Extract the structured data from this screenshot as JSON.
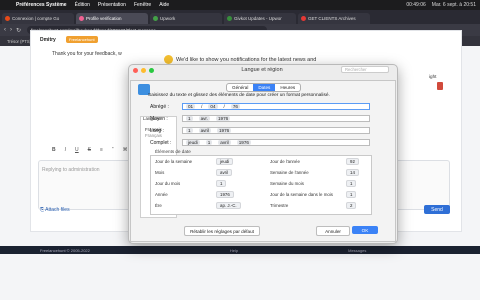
{
  "menubar": {
    "app": "Préférences Système",
    "items": [
      "Édition",
      "Présentation",
      "Fenêtre",
      "Aide"
    ],
    "clock": "Mar. 6 sept. à 20:51",
    "status": "00:49:06"
  },
  "tabs": [
    {
      "label": "Connexion | compte Go",
      "color": "#e64a19",
      "active": false
    },
    {
      "label": "Profile verification",
      "color": "#f06292",
      "active": true
    },
    {
      "label": "Upwork",
      "color": "#43a047",
      "active": false
    },
    {
      "label": "Givkot Updates - Upwor",
      "color": "#388e3c",
      "active": false
    },
    {
      "label": "GET CLIENTS Archives",
      "color": "#e53935",
      "active": false
    }
  ],
  "url": "freelancehunt.com/mailbox/read/thread/600123/#last-message",
  "bookmarks": [
    "Trésor (PTS)",
    "Livre - Éditions D.",
    "Chat with Le LIS",
    "Mémo Extra - Utilis",
    "ActuaBlitz | RBSE",
    "The Webinare | Ro",
    "Connexion | Sasa",
    "Prise en charge"
  ],
  "chat": {
    "user": "Dmitry",
    "badge": "Freelancehunt",
    "message": "Thank you for your feedback, w",
    "reply_placeholder": "Replying to administration",
    "attach": "Attach files",
    "send": "Send",
    "right_label": "ight",
    "toolbar": [
      "B",
      "I",
      "U",
      "S",
      "≡",
      "“",
      "⌘"
    ]
  },
  "notification": "We'd like to show you notifications for the latest news and",
  "footer": {
    "left": "Freelancehunt © 2005-2022",
    "mid": "Help",
    "right": "Messages"
  },
  "prefwin": {
    "title": "Langue et région",
    "search_placeholder": "Rechercher",
    "seg": [
      {
        "label": "Général",
        "selected": false
      },
      {
        "label": "Dates",
        "selected": true
      },
      {
        "label": "Heures",
        "selected": false
      }
    ],
    "hint": "Saisissez du texte et glissez des éléments de date pour créer un format personnalisé.",
    "left_title": "Langues",
    "left_items": [
      "Français",
      "Français"
    ],
    "rows": [
      {
        "label": "Abrégé :",
        "tokens": [
          "01",
          "/",
          "04",
          "/",
          "76"
        ],
        "focus": true
      },
      {
        "label": "Moyen :",
        "tokens": [
          "1",
          "avr.",
          "1976"
        ],
        "focus": false
      },
      {
        "label": "Long :",
        "tokens": [
          "1",
          "avril",
          "1976"
        ],
        "focus": false
      },
      {
        "label": "Complet :",
        "tokens": [
          "jeudi",
          "1",
          "avril",
          "1976"
        ],
        "focus": false
      }
    ],
    "elements_title": "Éléments de date",
    "elements_left": [
      {
        "label": "Jour de la semaine",
        "token": "jeudi"
      },
      {
        "label": "Mois",
        "token": "avril"
      },
      {
        "label": "Jour du mois",
        "token": "1"
      },
      {
        "label": "Année",
        "token": "1976"
      },
      {
        "label": "Ère",
        "token": "ap. J.-C."
      }
    ],
    "elements_right": [
      {
        "label": "Jour de l'année",
        "token": "92"
      },
      {
        "label": "Semaine de l'année",
        "token": "14"
      },
      {
        "label": "Semaine du mois",
        "token": "1"
      },
      {
        "label": "Jour de la semaine dans le mois",
        "token": "1"
      },
      {
        "label": "Trimestre",
        "token": "2"
      }
    ],
    "reset": "Rétablir les réglages par défaut",
    "cancel": "Annuler",
    "ok": "OK"
  }
}
